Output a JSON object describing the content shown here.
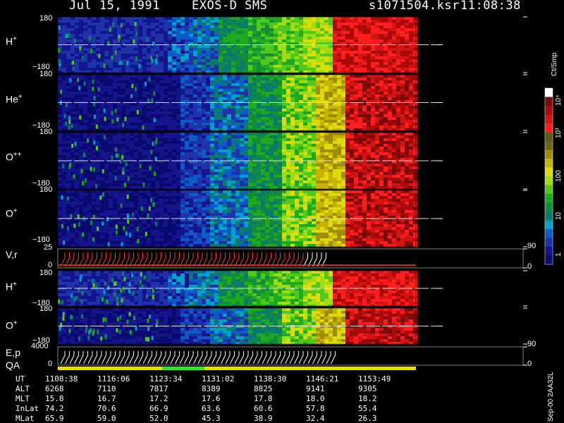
{
  "header": {
    "date": "Jul 15, 1991",
    "instrument": "EXOS-D SMS",
    "file": "s1071504.ksr",
    "time": "11:08:38"
  },
  "colors": {
    "background": "#000000",
    "palette": [
      "#0a0a6e",
      "#14148c",
      "#1e32aa",
      "#0a5ac8",
      "#00a0c8",
      "#0a7a6e",
      "#148c3c",
      "#1eaa1e",
      "#50c81e",
      "#a0dc14",
      "#dcdc0a",
      "#c8b400",
      "#a08c0a",
      "#6e6414",
      "#5a5a14",
      "#ff1e1e",
      "#d21414",
      "#aa0a0a",
      "#7a0a0a",
      "#ffffff"
    ]
  },
  "panels": [
    {
      "species": "H",
      "charge": "+",
      "ytop": "180",
      "ybot": "−180"
    },
    {
      "species": "He",
      "charge": "+",
      "ytop": "180",
      "ybot": "−180"
    },
    {
      "species": "O",
      "charge": "++",
      "ytop": "180",
      "ybot": "−180"
    },
    {
      "species": "O",
      "charge": "+",
      "ytop": "180",
      "ybot": "−180"
    },
    {
      "species": "V,r",
      "charge": "",
      "ytop": "25",
      "ybot": "0",
      "rtop": "90",
      "rbot": "0"
    },
    {
      "species": "H",
      "charge": "+",
      "ytop": "180",
      "ybot": "−180"
    },
    {
      "species": "O",
      "charge": "+",
      "ytop": "180",
      "ybot": "−180"
    },
    {
      "species": "E,p",
      "charge": "",
      "ytop": "4000",
      "ybot": "0",
      "rtop": "90",
      "rbot": "0"
    }
  ],
  "qa_label": "QA",
  "colorbar": {
    "unit": "Ct/Smp",
    "ticks": [
      "10⁴",
      "10³",
      "100",
      "10",
      "1"
    ]
  },
  "footer_version": "Sep-00  2AA32L",
  "table": {
    "row_labels": [
      "UT",
      "ALT",
      "MLT",
      "InLat",
      "MLat"
    ],
    "columns": [
      {
        "UT": "1108:38",
        "ALT": "6268",
        "MLT": "15.8",
        "InLat": "74.2",
        "MLat": "65.9"
      },
      {
        "UT": "1116:06",
        "ALT": "7110",
        "MLT": "16.7",
        "InLat": "70.6",
        "MLat": "59.0"
      },
      {
        "UT": "1123:34",
        "ALT": "7817",
        "MLT": "17.2",
        "InLat": "66.9",
        "MLat": "52.0"
      },
      {
        "UT": "1131:02",
        "ALT": "8389",
        "MLT": "17.6",
        "InLat": "63.6",
        "MLat": "45.3"
      },
      {
        "UT": "1138:30",
        "ALT": "8825",
        "MLT": "17.8",
        "InLat": "60.6",
        "MLat": "38.9"
      },
      {
        "UT": "1146:21",
        "ALT": "9141",
        "MLT": "18.0",
        "InLat": "57.8",
        "MLat": "32.4"
      },
      {
        "UT": "1153:49",
        "ALT": "9305",
        "MLT": "18.2",
        "InLat": "55.4",
        "MLat": "26.3"
      }
    ]
  },
  "chart_data": {
    "type": "heatmap",
    "title": "Jul 15, 1991   EXOS-D SMS",
    "x_ticks_ut": [
      "1108:38",
      "1116:06",
      "1123:34",
      "1131:02",
      "1138:30",
      "1146:21",
      "1153:49"
    ],
    "y_range_pitch_angle": [
      -180,
      180
    ],
    "color_scale": "log",
    "color_range": [
      1,
      10000
    ],
    "color_unit": "Ct/Smp",
    "panels": [
      "H+",
      "He+",
      "O++",
      "O+",
      "V,r",
      "H+",
      "O+",
      "E,p"
    ]
  }
}
